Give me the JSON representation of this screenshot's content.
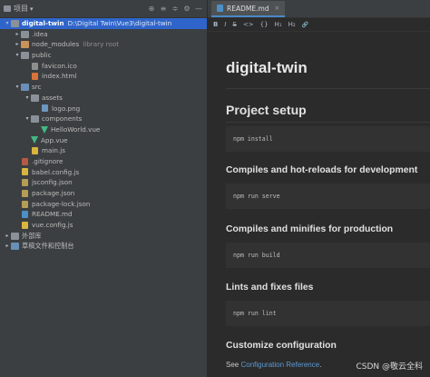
{
  "project_panel": {
    "title": "项目",
    "title_arrow": "▾",
    "header_icons": [
      "⊕",
      "≡",
      "≑",
      "⚙",
      "—"
    ],
    "tree": [
      {
        "label": "digital-twin",
        "extra": "D:\\Digital Twin\\Vue3\\digital-twin",
        "depth": 0,
        "kind": "folder",
        "expanded": true,
        "selected": true
      },
      {
        "label": ".idea",
        "depth": 1,
        "kind": "folder",
        "expanded": false
      },
      {
        "label": "node_modules",
        "extra": "library root",
        "depth": 1,
        "kind": "folder-orange",
        "expanded": false
      },
      {
        "label": "public",
        "depth": 1,
        "kind": "folder",
        "expanded": true
      },
      {
        "label": "favicon.ico",
        "depth": 2,
        "kind": "ico"
      },
      {
        "label": "index.html",
        "depth": 2,
        "kind": "html"
      },
      {
        "label": "src",
        "depth": 1,
        "kind": "folder-blue",
        "expanded": true
      },
      {
        "label": "assets",
        "depth": 2,
        "kind": "folder",
        "expanded": true
      },
      {
        "label": "logo.png",
        "depth": 3,
        "kind": "png"
      },
      {
        "label": "components",
        "depth": 2,
        "kind": "folder",
        "expanded": true
      },
      {
        "label": "HelloWorld.vue",
        "depth": 3,
        "kind": "vue"
      },
      {
        "label": "App.vue",
        "depth": 2,
        "kind": "vue"
      },
      {
        "label": "main.js",
        "depth": 2,
        "kind": "js"
      },
      {
        "label": ".gitignore",
        "depth": 1,
        "kind": "git"
      },
      {
        "label": "babel.config.js",
        "depth": 1,
        "kind": "js"
      },
      {
        "label": "jsconfig.json",
        "depth": 1,
        "kind": "json"
      },
      {
        "label": "package.json",
        "depth": 1,
        "kind": "json"
      },
      {
        "label": "package-lock.json",
        "depth": 1,
        "kind": "json"
      },
      {
        "label": "README.md",
        "depth": 1,
        "kind": "md"
      },
      {
        "label": "vue.config.js",
        "depth": 1,
        "kind": "js"
      },
      {
        "label": "外部库",
        "depth": 0,
        "kind": "lib",
        "expanded": false
      },
      {
        "label": "草稿文件和控制台",
        "depth": 0,
        "kind": "scratch",
        "expanded": false
      }
    ]
  },
  "editor": {
    "tab_label": "README.md",
    "tab_close": "×",
    "toolbar": [
      "B",
      "I",
      "S",
      "<>",
      "{}",
      "H₁",
      "H₂",
      "🔗"
    ],
    "doc": {
      "title": "digital-twin",
      "section": "Project setup",
      "code1": "npm install",
      "h_serve": "Compiles and hot-reloads for development",
      "code2": "npm run serve",
      "h_build": "Compiles and minifies for production",
      "code3": "npm run build",
      "h_lint": "Lints and fixes files",
      "code4": "npm run lint",
      "h_config": "Customize configuration",
      "see_prefix": "See ",
      "see_link": "Configuration Reference",
      "see_suffix": "."
    }
  },
  "watermark": "CSDN @敬云全科",
  "colors": {
    "selection": "#2f65ca",
    "link": "#5b9bd5",
    "vue": "#41b883"
  }
}
